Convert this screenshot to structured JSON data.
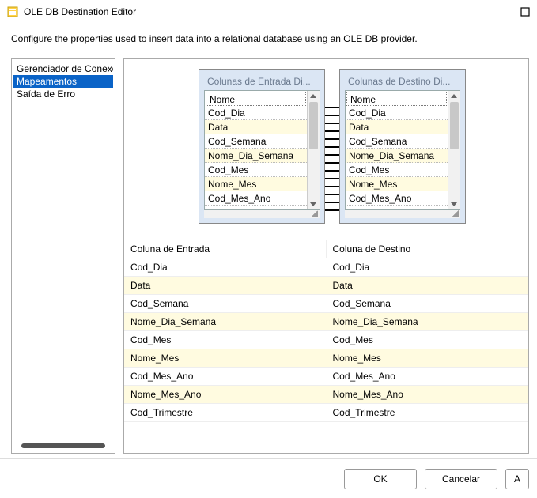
{
  "window": {
    "title": "OLE DB Destination Editor",
    "description": "Configure the properties used to insert data into a relational database using an OLE DB provider."
  },
  "sidebar": {
    "items": [
      {
        "label": "Gerenciador de Conexões",
        "selected": false
      },
      {
        "label": "Mapeamentos",
        "selected": true
      },
      {
        "label": "Saída de Erro",
        "selected": false
      }
    ]
  },
  "diagram": {
    "input_box": {
      "header": "Colunas de Entrada Di...",
      "rows": [
        "Nome",
        "Cod_Dia",
        "Data",
        "Cod_Semana",
        "Nome_Dia_Semana",
        "Cod_Mes",
        "Nome_Mes",
        "Cod_Mes_Ano"
      ]
    },
    "output_box": {
      "header": "Colunas de Destino Di...",
      "rows": [
        "Nome",
        "Cod_Dia",
        "Data",
        "Cod_Semana",
        "Nome_Dia_Semana",
        "Cod_Mes",
        "Nome_Mes",
        "Cod_Mes_Ano"
      ]
    },
    "connector_count": 14
  },
  "mapping_table": {
    "headers": {
      "input": "Coluna de Entrada",
      "output": "Coluna de Destino"
    },
    "rows": [
      {
        "input": "Cod_Dia",
        "output": "Cod_Dia"
      },
      {
        "input": "Data",
        "output": "Data"
      },
      {
        "input": "Cod_Semana",
        "output": "Cod_Semana"
      },
      {
        "input": "Nome_Dia_Semana",
        "output": "Nome_Dia_Semana"
      },
      {
        "input": "Cod_Mes",
        "output": "Cod_Mes"
      },
      {
        "input": "Nome_Mes",
        "output": "Nome_Mes"
      },
      {
        "input": "Cod_Mes_Ano",
        "output": "Cod_Mes_Ano"
      },
      {
        "input": "Nome_Mes_Ano",
        "output": "Nome_Mes_Ano"
      },
      {
        "input": "Cod_Trimestre",
        "output": "Cod_Trimestre"
      }
    ]
  },
  "footer": {
    "ok": "OK",
    "cancel": "Cancelar",
    "help": "A"
  }
}
